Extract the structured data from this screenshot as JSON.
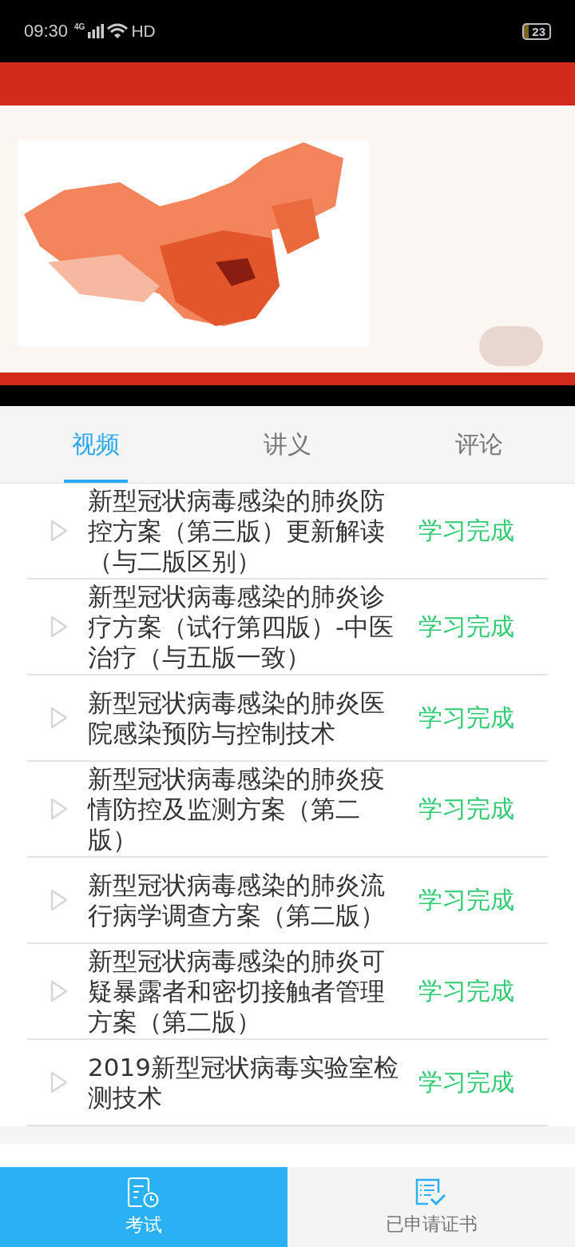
{
  "status_bar": {
    "time": "09:30",
    "network": "4G",
    "hd": "HD",
    "battery": "23"
  },
  "tabs": [
    {
      "label": "视频",
      "selected": true
    },
    {
      "label": "讲义",
      "selected": false
    },
    {
      "label": "评论",
      "selected": false
    }
  ],
  "lessons": [
    {
      "title": "新型冠状病毒感染的肺炎防控方案（第三版）更新解读（与二版区别）",
      "status": "学习完成"
    },
    {
      "title": "新型冠状病毒感染的肺炎诊疗方案（试行第四版）-中医治疗（与五版一致）",
      "status": "学习完成"
    },
    {
      "title": "新型冠状病毒感染的肺炎医院感染预防与控制技术",
      "status": "学习完成"
    },
    {
      "title": "新型冠状病毒感染的肺炎疫情防控及监测方案（第二版）",
      "status": "学习完成"
    },
    {
      "title": "新型冠状病毒感染的肺炎流行病学调查方案（第二版）",
      "status": "学习完成"
    },
    {
      "title": "新型冠状病毒感染的肺炎可疑暴露者和密切接触者管理方案（第二版）",
      "status": "学习完成"
    },
    {
      "title": "2019新型冠状病毒实验室检测技术",
      "status": "学习完成"
    }
  ],
  "bottom_nav": [
    {
      "label": "考试",
      "kind": "exam",
      "selected": true
    },
    {
      "label": "已申请证书",
      "kind": "certificate",
      "selected": false
    }
  ]
}
